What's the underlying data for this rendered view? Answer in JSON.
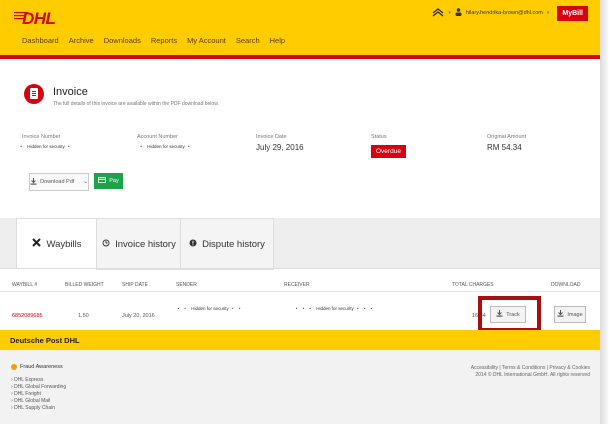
{
  "header": {
    "logo": "DHL",
    "user_email": "hilary.hendrika-brown@dhl.com",
    "mybill": "MyBill",
    "nav": [
      "Dashboard",
      "Archive",
      "Downloads",
      "Reports",
      "My Account",
      "Search",
      "Help"
    ]
  },
  "invoice": {
    "title": "Invoice",
    "subtitle": "The full details of this invoice are available within the PDF download below.",
    "invoice_number_label": "Invoice Number",
    "invoice_number_value": "Hidden for security",
    "account_number_label": "Account Number",
    "account_number_value": "Hidden for security",
    "invoice_date_label": "Invoice Date",
    "invoice_date_value": "July 29, 2016",
    "status_label": "Status",
    "status_value": "Overdue",
    "original_amount_label": "Original Amount",
    "original_amount_value": "RM 54.34",
    "download_label": "Download Pdf",
    "pay_label": "Pay"
  },
  "tabs": [
    {
      "label": "Waybills",
      "icon": "plane-icon"
    },
    {
      "label": "Invoice history",
      "icon": "history-icon"
    },
    {
      "label": "Dispute history",
      "icon": "alert-icon"
    }
  ],
  "table": {
    "headers": [
      "WAYBILL #",
      "BILLED WEIGHT",
      "SHIP DATE",
      "SENDER",
      "RECEIVER",
      "TOTAL CHARGES",
      "DOWNLOAD"
    ],
    "rows": [
      {
        "waybill": "6852089685",
        "billed_weight": "1.50",
        "ship_date": "July 20, 2016",
        "sender": "Hidden for security",
        "receiver": "Hidden for security",
        "total_charges": "16.34",
        "track_label": "Track",
        "image_label": "Image"
      }
    ]
  },
  "footer": {
    "brand": "Deutsche Post DHL",
    "fraud": "Fraud Awareness",
    "links": [
      "DHL Express",
      "DHL Global Forwarding",
      "DHL Freight",
      "DHL Global Mail",
      "DHL Supply Chain"
    ],
    "legal_links": "Accessibility | Terms & Conditions | Privacy & Cookies",
    "copyright": "2014 © DHL International GmbH. All rights reserved"
  },
  "colors": {
    "brand_yellow": "#ffcc00",
    "brand_red": "#d40511",
    "pay_green": "#1ea34a"
  }
}
